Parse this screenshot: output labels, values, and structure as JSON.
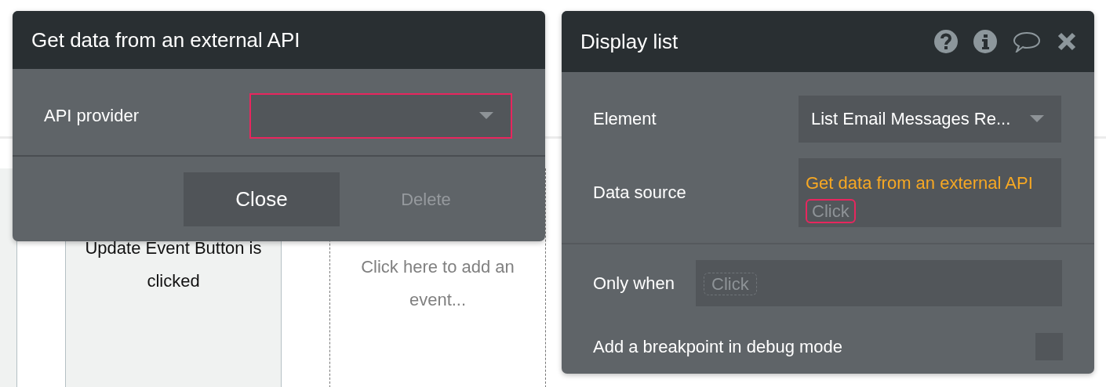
{
  "workflow_events": [
    {
      "kind": "event",
      "text": "Update Event Button is clicked"
    },
    {
      "kind": "add",
      "text": "Click here to add an event..."
    }
  ],
  "action_dialog": {
    "title": "Get data from an external API",
    "fields": [
      {
        "kind": "dropdown",
        "label": "API provider",
        "invalid": true
      }
    ],
    "buttons": [
      {
        "label": "Close",
        "disabled": false
      },
      {
        "label": "Delete",
        "disabled": true
      }
    ]
  },
  "property_dialog": {
    "title": "Display list",
    "fields": [
      {
        "kind": "dropdown",
        "label": "Element",
        "value": "List Email Messages Re...",
        "invalid": false
      },
      {
        "kind": "expression",
        "label": "Data source",
        "value": "Get data from an external API",
        "pill": "Click",
        "pill_invalid": true
      },
      {
        "kind": "expression",
        "label": "Only when",
        "pill": "Click",
        "pill_invalid": false
      },
      {
        "kind": "checkbox",
        "label": "Add a breakpoint in debug mode",
        "checked": false
      }
    ]
  }
}
